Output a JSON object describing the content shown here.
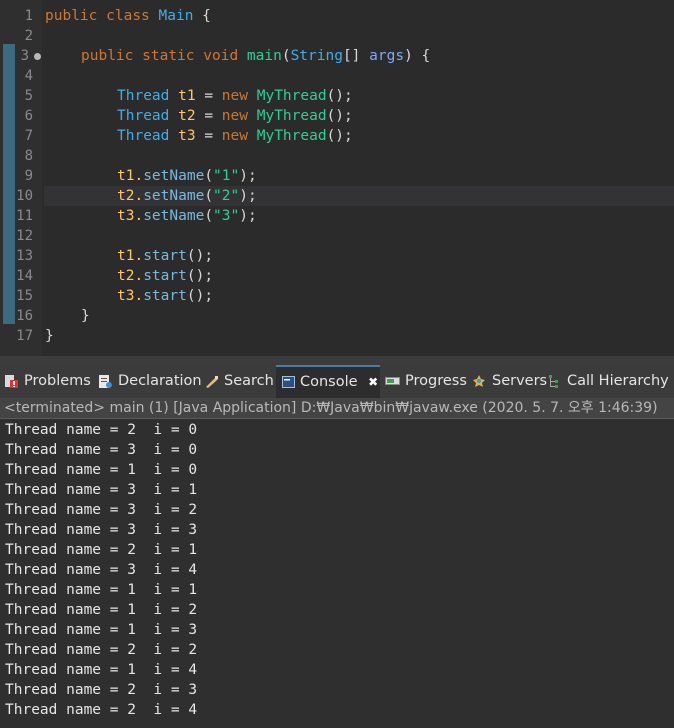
{
  "editor": {
    "line_numbers": [
      "1",
      "2",
      "3",
      "4",
      "5",
      "6",
      "7",
      "8",
      "9",
      "10",
      "11",
      "12",
      "13",
      "14",
      "15",
      "16",
      "17"
    ],
    "class_decl": {
      "public": "public",
      "class": "class",
      "name": "Main",
      "brace": " {"
    },
    "main_decl": {
      "public": "public",
      "static": "static",
      "void": "void",
      "name": "main",
      "open": "(",
      "type": "String",
      "arr": "[] ",
      "arg": "args",
      "close": ") {"
    },
    "threads": [
      {
        "type": "Thread",
        "var": "t1",
        "eq": " = ",
        "new": "new",
        "ctor": "MyThread",
        "end": "();"
      },
      {
        "type": "Thread",
        "var": "t2",
        "eq": " = ",
        "new": "new",
        "ctor": "MyThread",
        "end": "();"
      },
      {
        "type": "Thread",
        "var": "t3",
        "eq": " = ",
        "new": "new",
        "ctor": "MyThread",
        "end": "();"
      }
    ],
    "set_names": [
      {
        "obj": "t1.",
        "method": "setName",
        "open": "(",
        "str": "\"1\"",
        "close": ");"
      },
      {
        "obj": "t2.",
        "method": "setName",
        "open": "(",
        "str": "\"2\"",
        "close": ");"
      },
      {
        "obj": "t3.",
        "method": "setName",
        "open": "(",
        "str": "\"3\"",
        "close": ");"
      }
    ],
    "starts": [
      {
        "obj": "t1.",
        "method": "start",
        "end": "();"
      },
      {
        "obj": "t2.",
        "method": "start",
        "end": "();"
      },
      {
        "obj": "t3.",
        "method": "start",
        "end": "();"
      }
    ],
    "close_inner": "}",
    "close_outer": "}"
  },
  "tabs": [
    {
      "label": "Problems",
      "icon": "problems-icon"
    },
    {
      "label": "Declaration",
      "icon": "declaration-icon"
    },
    {
      "label": "Search",
      "icon": "search-icon"
    },
    {
      "label": "Console",
      "icon": "console-icon",
      "active": true,
      "close": "✖"
    },
    {
      "label": "Progress",
      "icon": "progress-icon"
    },
    {
      "label": "Servers",
      "icon": "servers-icon"
    },
    {
      "label": "Call Hierarchy",
      "icon": "call-hierarchy-icon"
    }
  ],
  "console": {
    "status": "<terminated> main (1) [Java Application] D:₩Java₩bin₩javaw.exe (2020. 5. 7. 오후 1:46:39)",
    "lines": [
      "Thread name = 2  i = 0",
      "Thread name = 3  i = 0",
      "Thread name = 1  i = 0",
      "Thread name = 3  i = 1",
      "Thread name = 3  i = 2",
      "Thread name = 3  i = 3",
      "Thread name = 2  i = 1",
      "Thread name = 3  i = 4",
      "Thread name = 1  i = 1",
      "Thread name = 1  i = 2",
      "Thread name = 1  i = 3",
      "Thread name = 2  i = 2",
      "Thread name = 1  i = 4",
      "Thread name = 2  i = 3",
      "Thread name = 2  i = 4"
    ]
  }
}
